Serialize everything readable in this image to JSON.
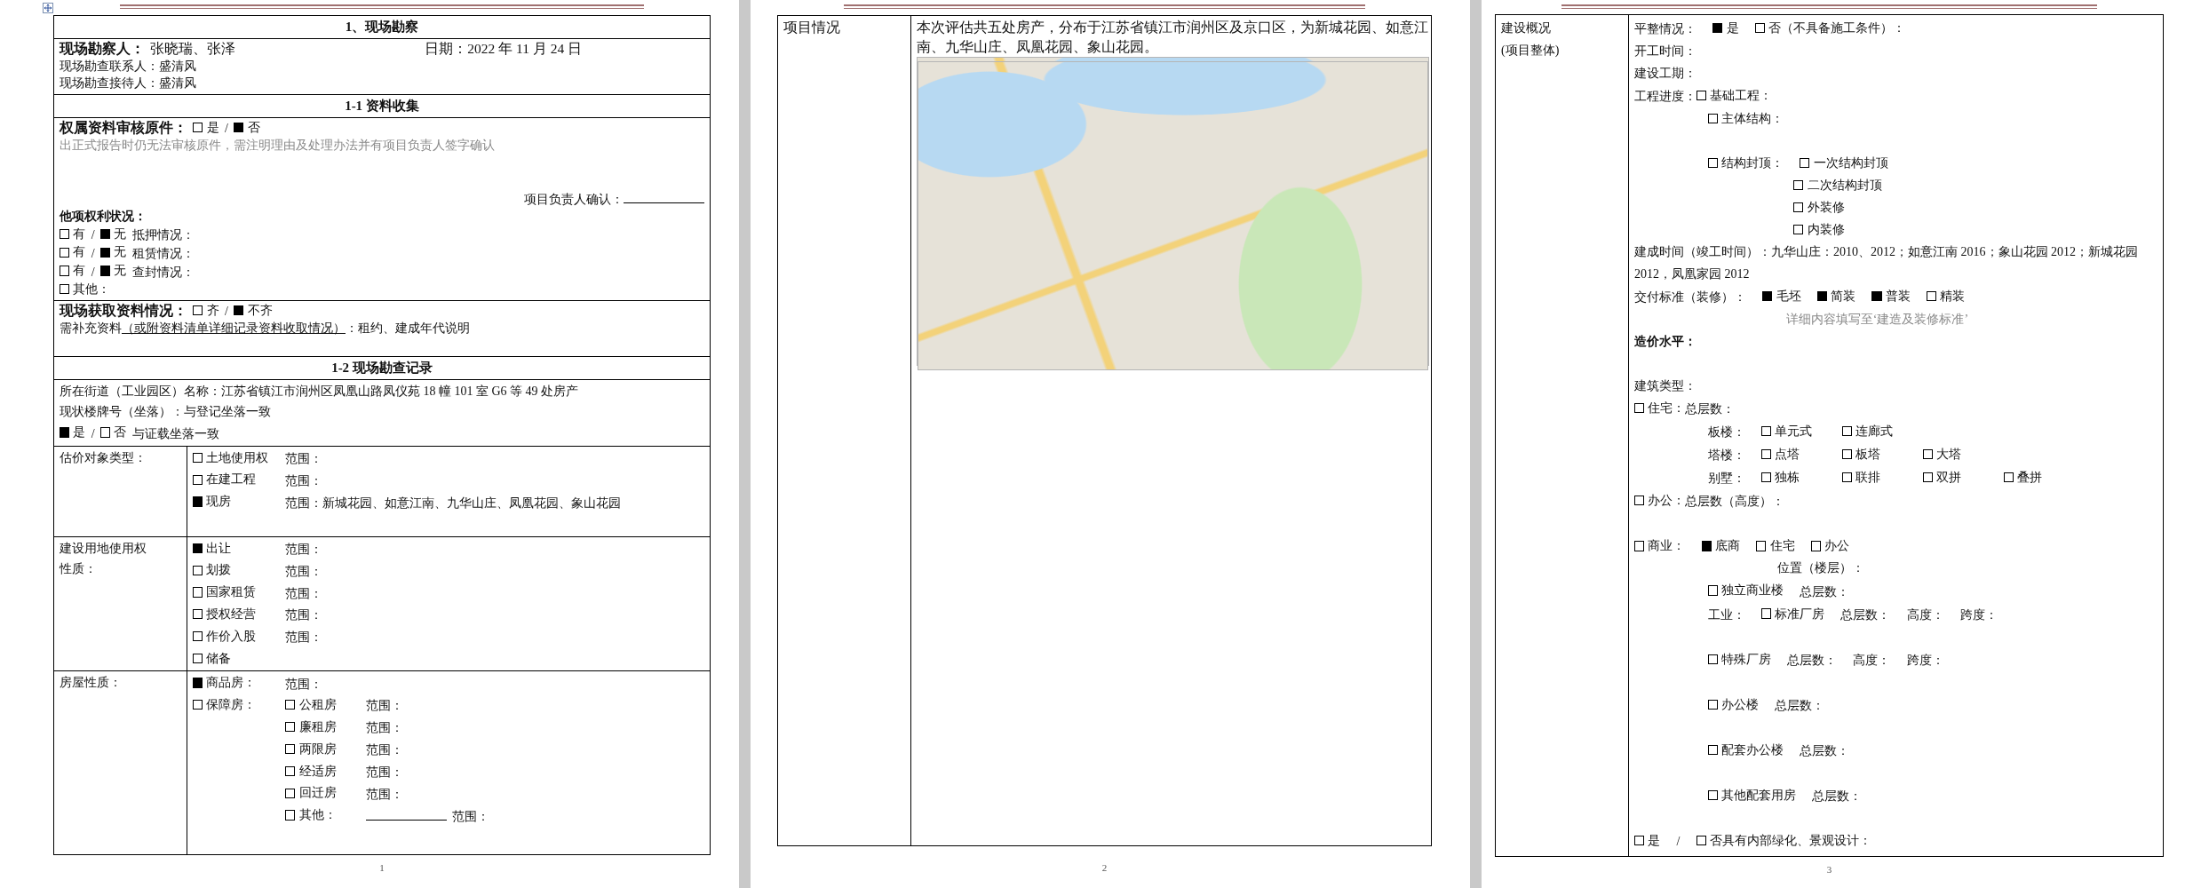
{
  "pages": [
    {
      "page_number": "1",
      "rows": [
        {
          "kind": "heading",
          "text": "1、现场勘察"
        },
        {
          "kind": "block",
          "lines": [
            {
              "kind": "pair",
              "items": [
                {
                  "kind": "label",
                  "text": "现场勘察人："
                },
                {
                  "kind": "big-text",
                  "text": "张晓瑞、张泽"
                },
                {
                  "kind": "big-text",
                  "text": "日期：2022 年 11 月 24 日"
                }
              ]
            },
            {
              "kind": "plain",
              "items": [
                {
                  "kind": "text",
                  "text": "现场勘查联系人：盛清风"
                }
              ]
            },
            {
              "kind": "plain",
              "items": [
                {
                  "kind": "text",
                  "text": "现场勘查接待人：盛清风"
                }
              ]
            }
          ]
        },
        {
          "kind": "heading",
          "text": "1-1  资料收集"
        },
        {
          "kind": "block",
          "lines": [
            {
              "kind": "plain",
              "items": [
                {
                  "kind": "label",
                  "text": "权属资料审核原件："
                },
                {
                  "kind": "check",
                  "checked": false,
                  "text": "是"
                },
                {
                  "kind": "text",
                  "text": "/"
                },
                {
                  "kind": "check",
                  "checked": true,
                  "text": "否"
                }
              ]
            },
            {
              "kind": "plain",
              "items": [
                {
                  "kind": "hint",
                  "text": "出正式报告时仍无法审核原件，需注明理由及处理办法并有项目负责人签字确认"
                }
              ]
            },
            {
              "kind": "blank"
            },
            {
              "kind": "blank"
            },
            {
              "kind": "right",
              "items": [
                {
                  "kind": "text",
                  "text": "项目负责人确认："
                },
                {
                  "kind": "blank-line"
                }
              ]
            },
            {
              "kind": "plain",
              "items": [
                {
                  "kind": "small-label",
                  "text": "他项权利状况："
                }
              ]
            },
            {
              "kind": "plain",
              "items": [
                {
                  "kind": "check",
                  "checked": false,
                  "text": "有"
                },
                {
                  "kind": "text",
                  "text": "/"
                },
                {
                  "kind": "check",
                  "checked": true,
                  "text": "无"
                },
                {
                  "kind": "text",
                  "text": "抵押情况："
                }
              ]
            },
            {
              "kind": "plain",
              "items": [
                {
                  "kind": "check",
                  "checked": false,
                  "text": "有"
                },
                {
                  "kind": "text",
                  "text": "/"
                },
                {
                  "kind": "check",
                  "checked": true,
                  "text": "无"
                },
                {
                  "kind": "text",
                  "text": "租赁情况："
                }
              ]
            },
            {
              "kind": "plain",
              "items": [
                {
                  "kind": "check",
                  "checked": false,
                  "text": "有"
                },
                {
                  "kind": "text",
                  "text": "/"
                },
                {
                  "kind": "check",
                  "checked": true,
                  "text": "无"
                },
                {
                  "kind": "text",
                  "text": "查封情况："
                }
              ]
            },
            {
              "kind": "plain",
              "items": [
                {
                  "kind": "check",
                  "checked": false,
                  "text": "其他："
                }
              ]
            }
          ]
        },
        {
          "kind": "block",
          "lines": [
            {
              "kind": "plain",
              "items": [
                {
                  "kind": "label",
                  "text": "现场获取资料情况："
                },
                {
                  "kind": "check",
                  "checked": false,
                  "text": "齐"
                },
                {
                  "kind": "text",
                  "text": "/"
                },
                {
                  "kind": "check",
                  "checked": true,
                  "text": "不齐"
                }
              ]
            },
            {
              "kind": "tight",
              "items": [
                {
                  "kind": "text",
                  "text": "需补充资料"
                },
                {
                  "kind": "under",
                  "text": "（或附资料清单详细记录资料收取情况）"
                },
                {
                  "kind": "text",
                  "text": "：租约、建成年代说明"
                }
              ]
            },
            {
              "kind": "blank"
            }
          ]
        },
        {
          "kind": "heading",
          "text": "1-2  现场勘查记录"
        },
        {
          "kind": "block",
          "lines": [
            {
              "kind": "wide",
              "items": [
                {
                  "kind": "text",
                  "text": "所在街道（工业园区）名称：江苏省镇江市润州区凤凰山路凤仪苑 18 幢 101 室 G6 等 49 处房产"
                }
              ]
            },
            {
              "kind": "wide",
              "items": [
                {
                  "kind": "text",
                  "text": "现状楼牌号（坐落）：与登记坐落一致"
                }
              ]
            },
            {
              "kind": "wide",
              "items": [
                {
                  "kind": "check",
                  "checked": true,
                  "text": "是"
                },
                {
                  "kind": "text",
                  "text": "/"
                },
                {
                  "kind": "check",
                  "checked": false,
                  "text": "否"
                },
                {
                  "kind": "text",
                  "text": "与证载坐落一致"
                }
              ]
            }
          ]
        },
        {
          "kind": "split",
          "label_lines": [
            {
              "kind": "plain",
              "items": [
                {
                  "kind": "text",
                  "text": "估价对象类型："
                }
              ]
            }
          ],
          "lines": [
            {
              "kind": "option",
              "items": [
                {
                  "kind": "check",
                  "checked": false,
                  "text": "土地使用权"
                },
                {
                  "kind": "text",
                  "text": "范围："
                }
              ]
            },
            {
              "kind": "option",
              "items": [
                {
                  "kind": "check",
                  "checked": false,
                  "text": "在建工程"
                },
                {
                  "kind": "text",
                  "text": "范围："
                }
              ]
            },
            {
              "kind": "option",
              "items": [
                {
                  "kind": "check",
                  "checked": true,
                  "text": "现房"
                },
                {
                  "kind": "text",
                  "text": "范围：新城花园、如意江南、九华山庄、凤凰花园、象山花园"
                }
              ]
            },
            {
              "kind": "blank"
            }
          ]
        },
        {
          "kind": "split",
          "label_lines": [
            {
              "kind": "plain",
              "items": [
                {
                  "kind": "text",
                  "text": "建设用地使用权"
                }
              ]
            },
            {
              "kind": "plain",
              "items": [
                {
                  "kind": "text",
                  "text": "性质："
                }
              ]
            }
          ],
          "lines": [
            {
              "kind": "option",
              "items": [
                {
                  "kind": "check",
                  "checked": true,
                  "text": "出让"
                },
                {
                  "kind": "text",
                  "text": "范围："
                }
              ]
            },
            {
              "kind": "option",
              "items": [
                {
                  "kind": "check",
                  "checked": false,
                  "text": "划拨"
                },
                {
                  "kind": "text",
                  "text": "范围："
                }
              ]
            },
            {
              "kind": "option",
              "items": [
                {
                  "kind": "check",
                  "checked": false,
                  "text": "国家租赁"
                },
                {
                  "kind": "text",
                  "text": "范围："
                }
              ]
            },
            {
              "kind": "option",
              "items": [
                {
                  "kind": "check",
                  "checked": false,
                  "text": "授权经营"
                },
                {
                  "kind": "text",
                  "text": "范围："
                }
              ]
            },
            {
              "kind": "option",
              "items": [
                {
                  "kind": "check",
                  "checked": false,
                  "text": "作价入股"
                },
                {
                  "kind": "text",
                  "text": "范围："
                }
              ]
            },
            {
              "kind": "option",
              "items": [
                {
                  "kind": "check",
                  "checked": false,
                  "text": "储备"
                }
              ]
            }
          ]
        },
        {
          "kind": "split",
          "label_lines": [
            {
              "kind": "plain",
              "items": [
                {
                  "kind": "text",
                  "text": "房屋性质："
                }
              ]
            }
          ],
          "lines": [
            {
              "kind": "option",
              "items": [
                {
                  "kind": "check",
                  "checked": true,
                  "text": "商品房："
                },
                {
                  "kind": "text",
                  "text": "范围："
                }
              ]
            },
            {
              "kind": "option",
              "items": [
                {
                  "kind": "check",
                  "checked": false,
                  "text": "保障房："
                },
                {
                  "kind": "check",
                  "checked": false,
                  "text": "公租房"
                },
                {
                  "kind": "text",
                  "text": "范围："
                }
              ]
            },
            {
              "kind": "sub-option",
              "items": [
                {
                  "kind": "check",
                  "checked": false,
                  "text": "廉租房"
                },
                {
                  "kind": "text",
                  "text": "范围："
                }
              ]
            },
            {
              "kind": "sub-option",
              "items": [
                {
                  "kind": "check",
                  "checked": false,
                  "text": "两限房"
                },
                {
                  "kind": "text",
                  "text": "范围："
                }
              ]
            },
            {
              "kind": "sub-option",
              "items": [
                {
                  "kind": "check",
                  "checked": false,
                  "text": "经适房"
                },
                {
                  "kind": "text",
                  "text": "范围："
                }
              ]
            },
            {
              "kind": "sub-option",
              "items": [
                {
                  "kind": "check",
                  "checked": false,
                  "text": "回迁房"
                },
                {
                  "kind": "text",
                  "text": "范围："
                }
              ]
            },
            {
              "kind": "sub-option",
              "items": [
                {
                  "kind": "check",
                  "checked": false,
                  "text": "其他："
                },
                {
                  "kind": "blank-line"
                },
                {
                  "kind": "text",
                  "text": "范围："
                }
              ]
            }
          ]
        }
      ]
    },
    {
      "page_number": "2",
      "rows": [
        {
          "kind": "split",
          "label_lines": [
            {
              "kind": "para",
              "items": [
                {
                  "kind": "text",
                  "text": "项目情况"
                }
              ]
            }
          ],
          "lines": [
            {
              "kind": "para",
              "items": [
                {
                  "kind": "text",
                  "text": "本次评估共五处房产，分布于江苏省镇江市润州区及京口区，为新城花园、如意江南、九华山庄、凤凰花园、象山花园。"
                }
              ]
            },
            {
              "kind": "map"
            }
          ]
        }
      ]
    },
    {
      "page_number": "3",
      "rows": [
        {
          "kind": "split",
          "label_lines": [
            {
              "kind": "plain",
              "items": [
                {
                  "kind": "text",
                  "text": "建设概况"
                }
              ]
            },
            {
              "kind": "plain",
              "items": [
                {
                  "kind": "text",
                  "text": "(项目整体)"
                }
              ]
            }
          ],
          "lines": [
            {
              "kind": "plain",
              "items": [
                {
                  "kind": "text",
                  "text": "平整情况："
                },
                {
                  "kind": "check",
                  "checked": true,
                  "text": "是"
                },
                {
                  "kind": "check",
                  "checked": false,
                  "text": "否（不具备施工条件）："
                }
              ]
            },
            {
              "kind": "plain",
              "items": [
                {
                  "kind": "text",
                  "text": "开工时间："
                }
              ]
            },
            {
              "kind": "plain",
              "items": [
                {
                  "kind": "text",
                  "text": "建设工期："
                }
              ]
            },
            {
              "kind": "tight",
              "items": [
                {
                  "kind": "text",
                  "text": "工程进度："
                },
                {
                  "kind": "check",
                  "checked": false,
                  "text": "基础工程："
                }
              ]
            },
            {
              "kind": "indent1",
              "items": [
                {
                  "kind": "check",
                  "checked": false,
                  "text": "主体结构："
                }
              ]
            },
            {
              "kind": "blank"
            },
            {
              "kind": "indent1",
              "items": [
                {
                  "kind": "check",
                  "checked": false,
                  "text": "结构封顶："
                },
                {
                  "kind": "check",
                  "checked": false,
                  "text": "一次结构封顶"
                }
              ]
            },
            {
              "kind": "indent2",
              "items": [
                {
                  "kind": "check",
                  "checked": false,
                  "text": "二次结构封顶"
                }
              ]
            },
            {
              "kind": "indent2",
              "items": [
                {
                  "kind": "check",
                  "checked": false,
                  "text": "外装修"
                }
              ]
            },
            {
              "kind": "indent2",
              "items": [
                {
                  "kind": "check",
                  "checked": false,
                  "text": "内装修"
                }
              ]
            },
            {
              "kind": "plain",
              "items": [
                {
                  "kind": "text",
                  "text": "建成时间（竣工时间）：九华山庄：2010、2012；如意江南 2016；象山花园 2012；新城花园 2012，凤凰家园 2012"
                }
              ]
            },
            {
              "kind": "plain",
              "items": [
                {
                  "kind": "text",
                  "text": "交付标准（装修）："
                },
                {
                  "kind": "check",
                  "checked": true,
                  "text": "毛坯"
                },
                {
                  "kind": "check",
                  "checked": true,
                  "text": "简装"
                },
                {
                  "kind": "check",
                  "checked": true,
                  "text": "普装"
                },
                {
                  "kind": "check",
                  "checked": false,
                  "text": "精装"
                }
              ]
            },
            {
              "kind": "center",
              "items": [
                {
                  "kind": "hint",
                  "text": "详细内容填写至‘建造及装修标准’"
                }
              ]
            },
            {
              "kind": "plain",
              "items": [
                {
                  "kind": "small-label",
                  "text": "造价水平："
                }
              ]
            },
            {
              "kind": "blank"
            },
            {
              "kind": "plain",
              "items": [
                {
                  "kind": "text",
                  "text": "建筑类型："
                }
              ]
            },
            {
              "kind": "tight",
              "items": [
                {
                  "kind": "check",
                  "checked": false,
                  "text": "住宅："
                },
                {
                  "kind": "text",
                  "text": "总层数："
                }
              ]
            },
            {
              "kind": "indent1-cols",
              "items": [
                {
                  "kind": "text",
                  "text": "板楼："
                },
                {
                  "kind": "check",
                  "checked": false,
                  "text": "单元式"
                },
                {
                  "kind": "check",
                  "checked": false,
                  "text": "连廊式"
                }
              ]
            },
            {
              "kind": "indent1-cols",
              "items": [
                {
                  "kind": "text",
                  "text": "塔楼："
                },
                {
                  "kind": "check",
                  "checked": false,
                  "text": "点塔"
                },
                {
                  "kind": "check",
                  "checked": false,
                  "text": "板塔"
                },
                {
                  "kind": "check",
                  "checked": false,
                  "text": "大塔"
                }
              ]
            },
            {
              "kind": "indent1-cols",
              "items": [
                {
                  "kind": "text",
                  "text": "别墅："
                },
                {
                  "kind": "check",
                  "checked": false,
                  "text": "独栋"
                },
                {
                  "kind": "check",
                  "checked": false,
                  "text": "联排"
                },
                {
                  "kind": "check",
                  "checked": false,
                  "text": "双拼"
                },
                {
                  "kind": "check",
                  "checked": false,
                  "text": "叠拼"
                }
              ]
            },
            {
              "kind": "tight",
              "items": [
                {
                  "kind": "check",
                  "checked": false,
                  "text": "办公："
                },
                {
                  "kind": "text",
                  "text": "总层数（高度）："
                }
              ]
            },
            {
              "kind": "blank"
            },
            {
              "kind": "plain",
              "items": [
                {
                  "kind": "check",
                  "checked": false,
                  "text": "商业："
                },
                {
                  "kind": "check",
                  "checked": true,
                  "text": "底商"
                },
                {
                  "kind": "check",
                  "checked": false,
                  "text": "住宅"
                },
                {
                  "kind": "check",
                  "checked": false,
                  "text": "办公"
                }
              ]
            },
            {
              "kind": "indent3",
              "items": [
                {
                  "kind": "text",
                  "text": "位置（楼层）："
                }
              ]
            },
            {
              "kind": "indent1",
              "items": [
                {
                  "kind": "check",
                  "checked": false,
                  "text": "独立商业楼"
                },
                {
                  "kind": "text",
                  "text": "总层数："
                }
              ]
            },
            {
              "kind": "indent1",
              "items": [
                {
                  "kind": "text",
                  "text": "工业："
                },
                {
                  "kind": "check",
                  "checked": false,
                  "text": "标准厂房"
                },
                {
                  "kind": "text",
                  "text": "总层数："
                },
                {
                  "kind": "text",
                  "text": "高度："
                },
                {
                  "kind": "text",
                  "text": "跨度："
                }
              ]
            },
            {
              "kind": "blank"
            },
            {
              "kind": "indent1",
              "items": [
                {
                  "kind": "check",
                  "checked": false,
                  "text": "特殊厂房"
                },
                {
                  "kind": "text",
                  "text": "总层数："
                },
                {
                  "kind": "text",
                  "text": "高度："
                },
                {
                  "kind": "text",
                  "text": "跨度："
                }
              ]
            },
            {
              "kind": "blank"
            },
            {
              "kind": "indent1",
              "items": [
                {
                  "kind": "check",
                  "checked": false,
                  "text": "办公楼"
                },
                {
                  "kind": "text",
                  "text": "总层数："
                }
              ]
            },
            {
              "kind": "blank"
            },
            {
              "kind": "indent1",
              "items": [
                {
                  "kind": "check",
                  "checked": false,
                  "text": "配套办公楼"
                },
                {
                  "kind": "text",
                  "text": "总层数："
                }
              ]
            },
            {
              "kind": "blank"
            },
            {
              "kind": "indent1",
              "items": [
                {
                  "kind": "check",
                  "checked": false,
                  "text": "其他配套用房"
                },
                {
                  "kind": "text",
                  "text": "总层数："
                }
              ]
            },
            {
              "kind": "blank"
            },
            {
              "kind": "plain",
              "items": [
                {
                  "kind": "check",
                  "checked": false,
                  "text": "是"
                },
                {
                  "kind": "text",
                  "text": "/"
                },
                {
                  "kind": "check",
                  "checked": false,
                  "text": "否具有内部绿化、景观设计："
                }
              ]
            }
          ]
        }
      ]
    }
  ]
}
